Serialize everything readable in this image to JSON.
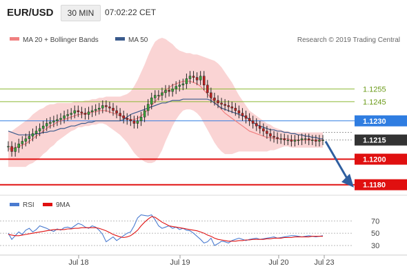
{
  "header": {
    "symbol": "EUR/USD",
    "timeframe": "30 MIN",
    "time": "07:02:22 CET"
  },
  "chart_data": [
    {
      "type": "candlestick",
      "legend": [
        {
          "name": "MA 20 + Bollinger Bands",
          "color": "#f08080"
        },
        {
          "name": "MA 50",
          "color": "#3a5a8c"
        }
      ],
      "watermark": "Research © 2019 Trading Central",
      "ylim": [
        1.1175,
        1.1288
      ],
      "x_ticks": [
        "Jul 18",
        "Jul 19",
        "Jul 20",
        "Jul 23"
      ],
      "levels": [
        {
          "label": "1.1255",
          "value": 1.1255,
          "color": "#8ab832",
          "text_color": "#6a9a18",
          "style": "thin",
          "tag": "text"
        },
        {
          "label": "1.1245",
          "value": 1.1245,
          "color": "#8ab832",
          "text_color": "#6a9a18",
          "style": "thin",
          "tag": "text"
        },
        {
          "label": "1.1230",
          "value": 1.123,
          "color": "#2f7de1",
          "text_color": "#ffffff",
          "style": "thin",
          "tag": "box"
        },
        {
          "label": "1.1215",
          "value": 1.1215,
          "color": "#333333",
          "text_color": "#ffffff",
          "style": "current",
          "tag": "box"
        },
        {
          "label": "1.1200",
          "value": 1.12,
          "color": "#e01010",
          "text_color": "#ffffff",
          "style": "thick",
          "tag": "box"
        },
        {
          "label": "1.1180",
          "value": 1.118,
          "color": "#e01010",
          "text_color": "#ffffff",
          "style": "thick",
          "tag": "box"
        }
      ],
      "forecast_arrow": {
        "from": 1.1215,
        "to": 1.118,
        "color": "#2f5fa0"
      },
      "close": [
        1.121,
        1.1206,
        1.1209,
        1.1212,
        1.1214,
        1.1216,
        1.1218,
        1.122,
        1.1222,
        1.1224,
        1.1226,
        1.1228,
        1.1229,
        1.123,
        1.1231,
        1.1232,
        1.1234,
        1.1235,
        1.1236,
        1.1238,
        1.1237,
        1.1236,
        1.1235,
        1.1237,
        1.1238,
        1.1239,
        1.124,
        1.1242,
        1.1241,
        1.124,
        1.1238,
        1.1236,
        1.1234,
        1.1232,
        1.1231,
        1.123,
        1.1228,
        1.123,
        1.1233,
        1.1238,
        1.1243,
        1.1248,
        1.125,
        1.125,
        1.1252,
        1.1254,
        1.1253,
        1.1255,
        1.1257,
        1.1258,
        1.1259,
        1.1263,
        1.1265,
        1.1264,
        1.1262,
        1.1265,
        1.1258,
        1.1252,
        1.1248,
        1.1246,
        1.1244,
        1.1243,
        1.1242,
        1.1241,
        1.124,
        1.1238,
        1.1236,
        1.1234,
        1.1232,
        1.123,
        1.1228,
        1.1226,
        1.1224,
        1.1222,
        1.122,
        1.1218,
        1.1217,
        1.1216,
        1.1216,
        1.1215,
        1.1215,
        1.1214,
        1.1215,
        1.1215,
        1.1216,
        1.1216,
        1.1215,
        1.1215,
        1.1214,
        1.1215,
        1.1215
      ],
      "ma20": [
        1.1208,
        1.1208,
        1.1209,
        1.121,
        1.1211,
        1.1212,
        1.1214,
        1.1216,
        1.1218,
        1.122,
        1.1222,
        1.1224,
        1.1226,
        1.1227,
        1.1229,
        1.123,
        1.1231,
        1.1232,
        1.1233,
        1.1234,
        1.1235,
        1.1235,
        1.1236,
        1.1236,
        1.1237,
        1.1237,
        1.1238,
        1.1238,
        1.1238,
        1.1237,
        1.1236,
        1.1235,
        1.1234,
        1.1233,
        1.1232,
        1.1231,
        1.1231,
        1.1232,
        1.1234,
        1.1236,
        1.1239,
        1.1242,
        1.1245,
        1.1248,
        1.1251,
        1.1254,
        1.1256,
        1.1258,
        1.1259,
        1.126,
        1.1261,
        1.1261,
        1.1261,
        1.126,
        1.1259,
        1.1257,
        1.1254,
        1.1251,
        1.1248,
        1.1245,
        1.1242,
        1.1239,
        1.1236,
        1.1234,
        1.1232,
        1.123,
        1.1228,
        1.1226,
        1.1224,
        1.1222,
        1.1221,
        1.122,
        1.1219,
        1.1218,
        1.1217,
        1.1217,
        1.1216,
        1.1216,
        1.1216,
        1.1216,
        1.1216,
        1.1215,
        1.1215,
        1.1215,
        1.1215,
        1.1215,
        1.1215,
        1.1215,
        1.1215,
        1.1215,
        1.1215
      ],
      "ma50": [
        1.1222,
        1.1221,
        1.122,
        1.1219,
        1.1219,
        1.1219,
        1.1219,
        1.1219,
        1.122,
        1.122,
        1.1221,
        1.1221,
        1.1222,
        1.1222,
        1.1223,
        1.1224,
        1.1224,
        1.1225,
        1.1226,
        1.1226,
        1.1227,
        1.1228,
        1.1228,
        1.1229,
        1.1229,
        1.123,
        1.123,
        1.123,
        1.123,
        1.123,
        1.123,
        1.123,
        1.123,
        1.1231,
        1.1233,
        1.1235,
        1.1236,
        1.1237,
        1.1238,
        1.1239,
        1.124,
        1.1241,
        1.1242,
        1.1243,
        1.1244,
        1.1244,
        1.1245,
        1.1246,
        1.1246,
        1.1246,
        1.1247,
        1.1247,
        1.1247,
        1.1247,
        1.1247,
        1.1247,
        1.1247,
        1.1247,
        1.1246,
        1.1244,
        1.1242,
        1.124,
        1.1239,
        1.1238,
        1.1237,
        1.1236,
        1.1235,
        1.1234,
        1.1233,
        1.1231,
        1.1229,
        1.1227,
        1.1226,
        1.1225,
        1.1224,
        1.1223,
        1.1223,
        1.1222,
        1.1222,
        1.1221,
        1.1221,
        1.122,
        1.122,
        1.1219,
        1.1219,
        1.1218,
        1.1218,
        1.1217,
        1.1217,
        1.1216,
        1.1216
      ],
      "bb_width": [
        0.0014,
        0.0014,
        0.0015,
        0.0016,
        0.0017,
        0.0018,
        0.0018,
        0.0019,
        0.0019,
        0.0019,
        0.0018,
        0.0018,
        0.0017,
        0.0016,
        0.0015,
        0.0014,
        0.0013,
        0.0012,
        0.0011,
        0.0011,
        0.001,
        0.001,
        0.001,
        0.001,
        0.001,
        0.001,
        0.001,
        0.001,
        0.0011,
        0.0012,
        0.0013,
        0.0014,
        0.0015,
        0.0017,
        0.0019,
        0.0022,
        0.0026,
        0.003,
        0.0034,
        0.0038,
        0.0042,
        0.0045,
        0.0047,
        0.0046,
        0.0044,
        0.004,
        0.0036,
        0.0032,
        0.0028,
        0.0025,
        0.0023,
        0.0022,
        0.0022,
        0.0022,
        0.0023,
        0.0024,
        0.0026,
        0.0028,
        0.003,
        0.0032,
        0.0033,
        0.0033,
        0.0032,
        0.003,
        0.0028,
        0.0025,
        0.0022,
        0.002,
        0.0018,
        0.0016,
        0.0015,
        0.0014,
        0.0013,
        0.0012,
        0.0011,
        0.001,
        0.0009,
        0.0008,
        0.0007,
        0.0006,
        0.0006,
        0.0006,
        0.0006,
        0.0006,
        0.0006,
        0.0006,
        0.0006,
        0.0006,
        0.0006,
        0.0006,
        0.0006
      ]
    },
    {
      "type": "line",
      "legend": [
        {
          "name": "RSI",
          "color": "#4a7bd0"
        },
        {
          "name": "9MA",
          "color": "#e01010"
        }
      ],
      "ylim": [
        20,
        85
      ],
      "y_ticks": [
        "70",
        "50",
        "30"
      ],
      "guides": [
        70,
        50,
        30
      ],
      "series": [
        {
          "name": "RSI",
          "color": "#4a7bd0",
          "values": [
            50,
            40,
            46,
            52,
            48,
            55,
            58,
            52,
            56,
            62,
            60,
            58,
            55,
            53,
            57,
            55,
            59,
            60,
            58,
            62,
            66,
            64,
            60,
            58,
            62,
            60,
            55,
            48,
            36,
            40,
            44,
            38,
            42,
            46,
            50,
            52,
            62,
            75,
            80,
            79,
            78,
            80,
            72,
            62,
            58,
            60,
            62,
            58,
            60,
            56,
            58,
            55,
            54,
            50,
            45,
            40,
            34,
            36,
            42,
            30,
            33,
            37,
            36,
            34,
            38,
            40,
            42,
            40,
            38,
            40,
            41,
            42,
            40,
            41,
            42,
            43,
            44,
            42,
            43,
            44,
            45,
            46,
            46,
            45,
            44,
            45,
            46,
            45,
            44,
            45,
            46
          ]
        },
        {
          "name": "9MA",
          "color": "#e01010",
          "values": [
            48,
            47,
            46,
            46,
            47,
            48,
            49,
            50,
            51,
            52,
            53,
            54,
            55,
            56,
            56,
            56,
            56,
            57,
            57,
            58,
            58,
            59,
            59,
            59,
            59,
            59,
            58,
            56,
            54,
            51,
            48,
            46,
            44,
            43,
            44,
            46,
            50,
            55,
            62,
            68,
            73,
            77,
            76,
            72,
            68,
            65,
            62,
            61,
            60,
            59,
            58,
            57,
            56,
            55,
            54,
            52,
            50,
            47,
            45,
            42,
            40,
            39,
            38,
            37,
            37,
            37,
            38,
            38,
            39,
            39,
            40,
            40,
            40,
            40,
            41,
            41,
            42,
            42,
            42,
            43,
            43,
            43,
            44,
            44,
            44,
            44,
            44,
            45,
            45,
            45,
            45
          ]
        }
      ]
    }
  ]
}
